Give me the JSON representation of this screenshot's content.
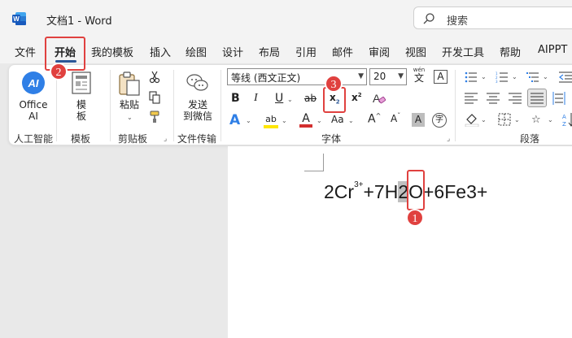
{
  "titlebar": {
    "doc_name": "文档1  -  Word",
    "search_placeholder": "搜索"
  },
  "tabs": [
    "文件",
    "开始",
    "我的模板",
    "插入",
    "绘图",
    "设计",
    "布局",
    "引用",
    "邮件",
    "审阅",
    "视图",
    "开发工具",
    "帮助",
    "AIPPT"
  ],
  "active_tab": "开始",
  "ribbon": {
    "office_ai": [
      "Office",
      "AI"
    ],
    "template_btn": [
      "模",
      "板"
    ],
    "paste_btn": "粘贴",
    "send_btn": [
      "发送",
      "到微信"
    ],
    "font_name": "等线 (西文正文)",
    "font_size": "20",
    "wen_top": "wén",
    "wen_char": "文",
    "A_box": "A",
    "bold": "B",
    "italic": "I",
    "underline": "U",
    "strike": "ab",
    "subscript": "x",
    "subscript_sub": "2",
    "superscript": "x",
    "superscript_sup": "2",
    "font_effect": "A",
    "highlight": "ab",
    "font_color": "A",
    "change_case": "Aa",
    "grow_font": "A",
    "shrink_font": "A",
    "char_shading": "A",
    "enclose": "字",
    "groups": {
      "ai": "人工智能",
      "template": "模板",
      "clipboard": "剪贴板",
      "transfer": "文件传输",
      "font": "字体",
      "paragraph": "段落"
    }
  },
  "document": {
    "eq_part1": "2Cr",
    "eq_sup": "3+",
    "eq_part2": "+7H",
    "eq_selected": "2",
    "eq_part3": "O+6Fe3+"
  },
  "annotations": {
    "badge1": "1",
    "badge2": "2",
    "badge3": "3"
  },
  "colors": {
    "accent_red": "#e0413f",
    "word_blue": "#2b5797",
    "highlight_yellow": "#ffe600",
    "font_red": "#d32f2f"
  }
}
